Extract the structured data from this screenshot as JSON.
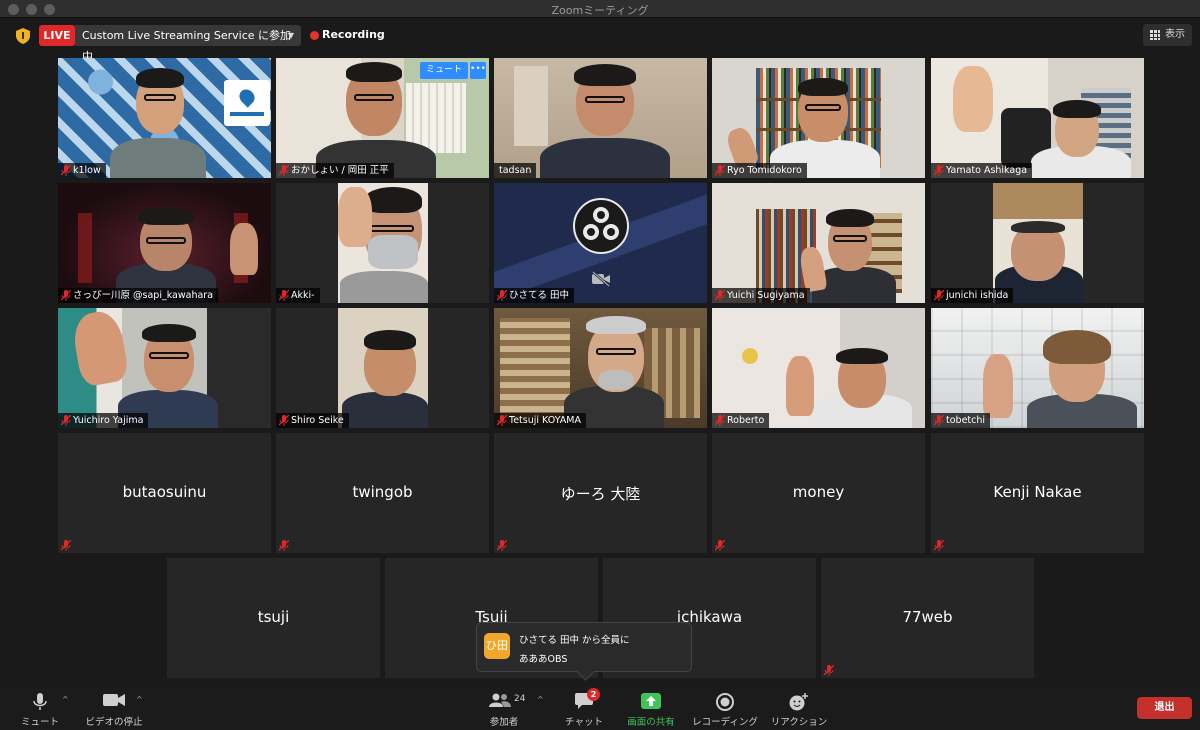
{
  "window": {
    "title": "Zoomミーティング"
  },
  "topbar": {
    "live_label": "LIVE",
    "stream_label": "Custom Live Streaming Service に参加中",
    "recording_label": "Recording",
    "view_label": "表示"
  },
  "tiles": {
    "r1": [
      "k1low",
      "おかしょい / 岡田 正平",
      "tadsan",
      "Ryo Tomidokoro",
      "Yamato Ashikaga"
    ],
    "r2": [
      "さっぴー川原 @sapi_kawahara",
      "Akki-",
      "ひさてる 田中",
      "Yuichi Sugiyama",
      "junichi ishida"
    ],
    "r3": [
      "Yuichiro Yajima",
      "Shiro Seike",
      "Tetsuji KOYAMA",
      "Roberto",
      "tobetchi"
    ],
    "r4": [
      "butaosuinu",
      "twingob",
      "ゆーろ 大陸",
      "money",
      "Kenji Nakae"
    ],
    "r5": [
      "tsuji",
      "Tsuji",
      "ichikawa",
      "77web"
    ]
  },
  "hover": {
    "mute_label": "ミュート",
    "more_label": "•••"
  },
  "toast": {
    "avatar": "ひ田",
    "from": "ひさてる 田中 から全員に",
    "message": "あああOBS"
  },
  "toolbar": {
    "mute": "ミュート",
    "video": "ビデオの停止",
    "participants": "参加者",
    "participant_count": "24",
    "chat": "チャット",
    "chat_badge": "2",
    "share": "画面の共有",
    "record": "レコーディング",
    "reactions": "リアクション",
    "leave": "退出"
  }
}
